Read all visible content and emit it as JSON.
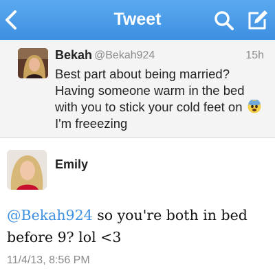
{
  "nav": {
    "title": "Tweet",
    "back_icon": "chevron-left-icon",
    "search_icon": "search-icon",
    "compose_icon": "compose-icon"
  },
  "reply_context": {
    "name": "Bekah",
    "handle": "@Bekah924",
    "time": "15h",
    "lines": [
      "Best part about being married?",
      "Having someone warm in the bed",
      "with you to stick your cold feet on",
      "I'm freeezing"
    ],
    "emoji": "fearful-face-emoji"
  },
  "tweet": {
    "name": "Emily",
    "mention": "@Bekah924",
    "text_line1": " so you're both in bed",
    "text_line2": "before 9? lol <3",
    "timestamp": "11/4/13, 8:56 PM"
  },
  "colors": {
    "nav_blue": "#3d8fe0",
    "mention_blue": "#3d8fe0",
    "context_bg": "#f4f4f4"
  }
}
